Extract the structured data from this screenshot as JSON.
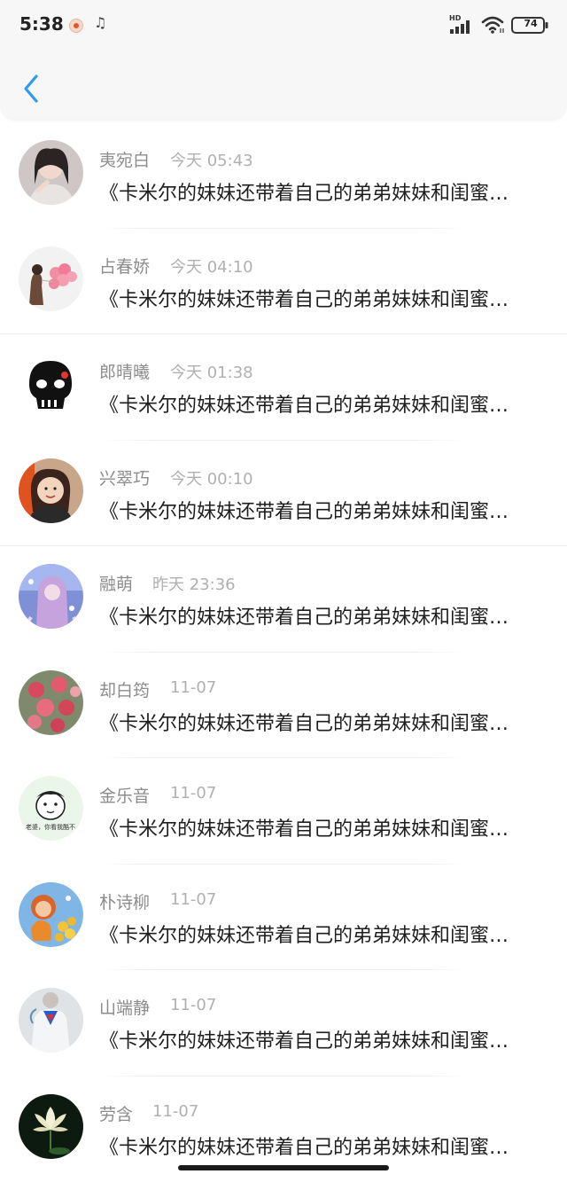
{
  "status_bar": {
    "time": "5:38",
    "network_label": "HD",
    "battery": "74"
  },
  "colors": {
    "accent": "#2f9bf0",
    "name_text": "#8c8c8c",
    "time_text": "#b0b0b0",
    "preview_text": "#1e1e1e"
  },
  "nav": {
    "back_icon": "chevron-left-icon"
  },
  "items": [
    {
      "name": "夷宛白",
      "time": "今天 05:43",
      "preview": "《卡米尔的妹妹还带着自己的弟弟妹妹和闺蜜…"
    },
    {
      "name": "占春娇",
      "time": "今天 04:10",
      "preview": "《卡米尔的妹妹还带着自己的弟弟妹妹和闺蜜…"
    },
    {
      "name": "郎晴曦",
      "time": "今天 01:38",
      "preview": "《卡米尔的妹妹还带着自己的弟弟妹妹和闺蜜…"
    },
    {
      "name": "兴翠巧",
      "time": "今天 00:10",
      "preview": "《卡米尔的妹妹还带着自己的弟弟妹妹和闺蜜…"
    },
    {
      "name": "融萌",
      "time": "昨天 23:36",
      "preview": "《卡米尔的妹妹还带着自己的弟弟妹妹和闺蜜…"
    },
    {
      "name": "却白筠",
      "time": "11-07",
      "preview": "《卡米尔的妹妹还带着自己的弟弟妹妹和闺蜜…"
    },
    {
      "name": "金乐音",
      "time": "11-07",
      "preview": "《卡米尔的妹妹还带着自己的弟弟妹妹和闺蜜…",
      "avatar_text": "老婆，你看我酷不"
    },
    {
      "name": "朴诗柳",
      "time": "11-07",
      "preview": "《卡米尔的妹妹还带着自己的弟弟妹妹和闺蜜…"
    },
    {
      "name": "山端静",
      "time": "11-07",
      "preview": "《卡米尔的妹妹还带着自己的弟弟妹妹和闺蜜…"
    },
    {
      "name": "劳含",
      "time": "11-07",
      "preview": "《卡米尔的妹妹还带着自己的弟弟妹妹和闺蜜…"
    }
  ]
}
